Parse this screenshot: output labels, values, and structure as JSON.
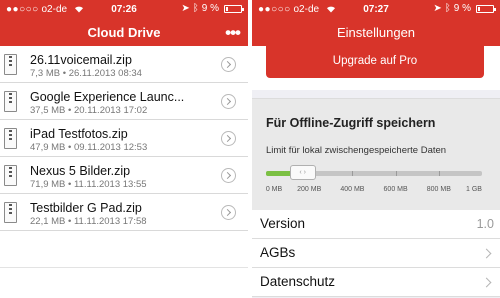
{
  "left": {
    "status": {
      "carrier": "o2-de",
      "time": "07:26",
      "battery": "9 %"
    },
    "title": "Cloud Drive",
    "more_label": "•••",
    "files": [
      {
        "name": "26.11voicemail.zip",
        "meta": "7,3 MB • 26.11.2013 08:34"
      },
      {
        "name": "Google Experience Launc...",
        "meta": "37,5 MB • 20.11.2013 17:02"
      },
      {
        "name": "iPad Testfotos.zip",
        "meta": "47,9 MB • 09.11.2013 12:53"
      },
      {
        "name": "Nexus 5 Bilder.zip",
        "meta": "71,9 MB • 11.11.2013 13:55"
      },
      {
        "name": "Testbilder G Pad.zip",
        "meta": "22,1 MB • 11.11.2013 17:58"
      }
    ]
  },
  "right": {
    "status": {
      "carrier": "o2-de",
      "time": "07:27",
      "battery": "9 %"
    },
    "title": "Einstellungen",
    "upgrade_label": "Upgrade auf Pro",
    "offline": {
      "title": "Für Offline-Zugriff speichern",
      "subtitle": "Limit für lokal zwischengespeicherte Daten",
      "slider_value_fraction": 0.17,
      "ticks": [
        "0 MB",
        "200 MB",
        "400 MB",
        "600 MB",
        "800 MB",
        "1 GB"
      ]
    },
    "rows": [
      {
        "label": "Version",
        "value": "1.0"
      },
      {
        "label": "AGBs"
      },
      {
        "label": "Datenschutz"
      }
    ]
  },
  "colors": {
    "brand_red": "#d8342a",
    "slider_green": "#7bc043"
  }
}
